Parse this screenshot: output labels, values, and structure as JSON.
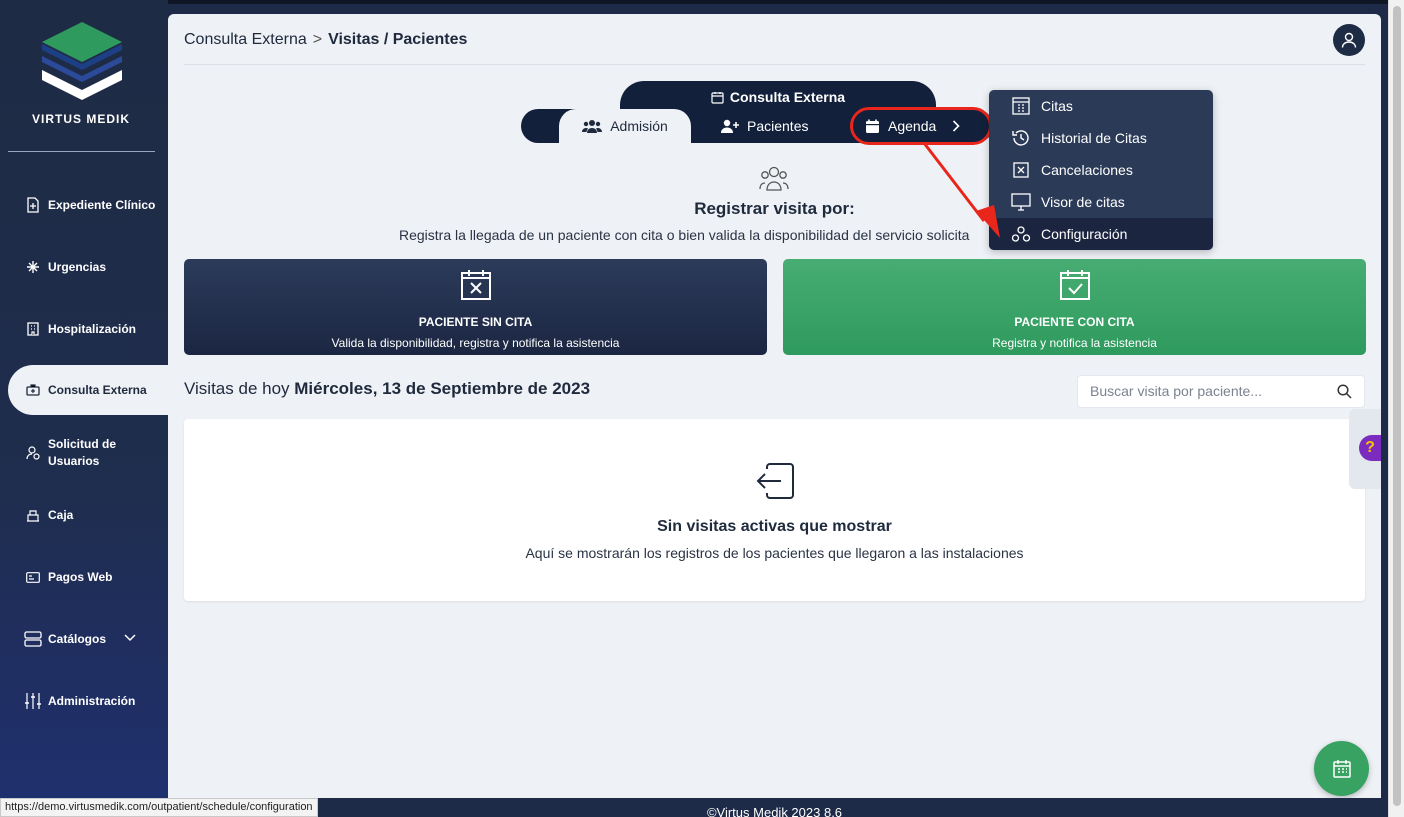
{
  "brand": {
    "name": "VIRTUS MEDIK"
  },
  "sidebar": {
    "items": [
      {
        "label": "Expediente Clínico",
        "icon": "file-plus-icon"
      },
      {
        "label": "Urgencias",
        "icon": "asterisk-icon"
      },
      {
        "label": "Hospitalización",
        "icon": "building-icon"
      },
      {
        "label": "Consulta Externa",
        "icon": "medical-case-icon",
        "active": true
      },
      {
        "label": "Solicitud de Usuarios",
        "icon": "user-request-icon"
      },
      {
        "label": "Caja",
        "icon": "cash-register-icon"
      },
      {
        "label": "Pagos Web",
        "icon": "card-icon"
      },
      {
        "label": "Catálogos",
        "icon": "stack-icon",
        "has_submenu": true
      },
      {
        "label": "Administración",
        "icon": "sliders-icon"
      }
    ]
  },
  "header": {
    "breadcrumb": {
      "parent": "Consulta Externa",
      "separator": ">",
      "current": "Visitas / Pacientes"
    }
  },
  "tabs": {
    "group_title": "Consulta Externa",
    "items": [
      {
        "label": "Admisión",
        "active": true
      },
      {
        "label": "Pacientes"
      },
      {
        "label": "Agenda",
        "highlighted": true
      }
    ]
  },
  "agenda_menu": {
    "items": [
      {
        "label": "Citas",
        "icon": "calendar-grid-icon"
      },
      {
        "label": "Historial de Citas",
        "icon": "history-icon"
      },
      {
        "label": "Cancelaciones",
        "icon": "cancel-box-icon"
      },
      {
        "label": "Visor de citas",
        "icon": "monitor-icon"
      },
      {
        "label": "Configuración",
        "icon": "config-icon",
        "hover": true
      }
    ]
  },
  "register": {
    "title": "Registrar visita por:",
    "subtitle": "Registra la llegada de un paciente con cita o bien valida la disponibilidad del servicio solicita"
  },
  "cards": {
    "sin_cita": {
      "title": "PACIENTE SIN CITA",
      "subtitle": "Valida la disponibilidad, registra y notifica la asistencia"
    },
    "con_cita": {
      "title": "PACIENTE CON CITA",
      "subtitle": "Registra y notifica la asistencia"
    }
  },
  "visits": {
    "prefix": "Visitas de hoy",
    "date": "Miércoles, 13 de Septiembre de 2023",
    "search_placeholder": "Buscar visita por paciente...",
    "empty_title": "Sin visitas activas que mostrar",
    "empty_subtitle": "Aquí se mostrarán los registros de los pacientes que llegaron a las instalaciones"
  },
  "help": {
    "label": "?"
  },
  "footer": {
    "text": "©Virtus Medik 2023 8.6"
  },
  "status_url": "https://demo.virtusmedik.com/outpatient/schedule/configuration",
  "colors": {
    "sidebar": "#1e2b44",
    "main_bg": "#eef1f6",
    "dark_card": "#1b2642",
    "green_card": "#2f9a5e",
    "annotation_red": "#e9261c",
    "help_purple": "#7b2cbf"
  }
}
